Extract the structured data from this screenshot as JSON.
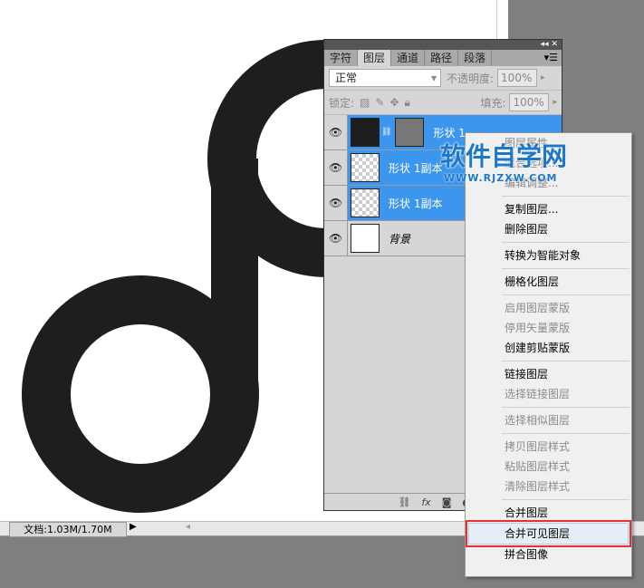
{
  "status": {
    "doc_info": "文档:1.03M/1.70M"
  },
  "panel": {
    "tabs": [
      "字符",
      "图层",
      "通道",
      "路径",
      "段落"
    ],
    "blend_mode": "正常",
    "opacity_label": "不透明度:",
    "opacity": "100%",
    "lock_label": "锁定:",
    "fill_label": "填充:",
    "fill": "100%",
    "layers": [
      {
        "name": "形状 1"
      },
      {
        "name": "形状 1副本"
      },
      {
        "name": "形状 1副本"
      },
      {
        "name": "背景"
      }
    ]
  },
  "menu": {
    "items": [
      "图层属性...",
      "混合选项...",
      "编辑调整...",
      "复制图层...",
      "删除图层",
      "转换为智能对象",
      "栅格化图层",
      "启用图层蒙版",
      "停用矢量蒙版",
      "创建剪贴蒙版",
      "链接图层",
      "选择链接图层",
      "选择相似图层",
      "拷贝图层样式",
      "粘贴图层样式",
      "清除图层样式",
      "合并图层",
      "合并可见图层",
      "拼合图像"
    ]
  },
  "watermark": {
    "text": "软件自学网",
    "url": "WWW.RJZXW.COM"
  }
}
